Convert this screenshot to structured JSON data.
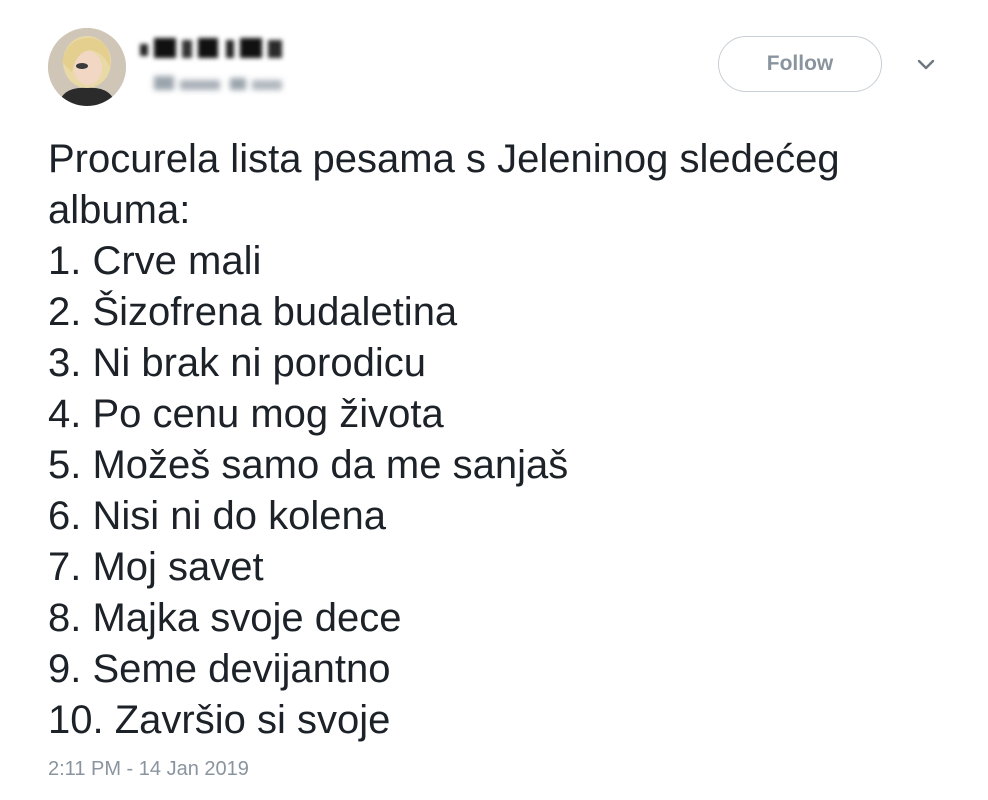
{
  "author": {
    "avatar_icon": "user-avatar"
  },
  "follow_button": {
    "label": "Follow"
  },
  "more_menu": {
    "icon": "chevron-down-icon"
  },
  "tweet": {
    "lines": [
      "Procurela lista pesama s Jeleninog sledećeg",
      "albuma:",
      "1. Crve mali",
      "2. Šizofrena budaletina",
      "3. Ni brak ni porodicu",
      "4. Po cenu mog života",
      "5. Možeš samo da me sanjaš",
      "6. Nisi ni do kolena",
      "7. Moj savet",
      "8. Majka svoje dece",
      "9. Seme devijantno",
      "10. Završio si svoje"
    ],
    "timestamp": "2:11 PM - 14 Jan 2019"
  },
  "colors": {
    "text": "#1c2228",
    "muted": "#8a949e",
    "border": "#c9cfd4"
  }
}
